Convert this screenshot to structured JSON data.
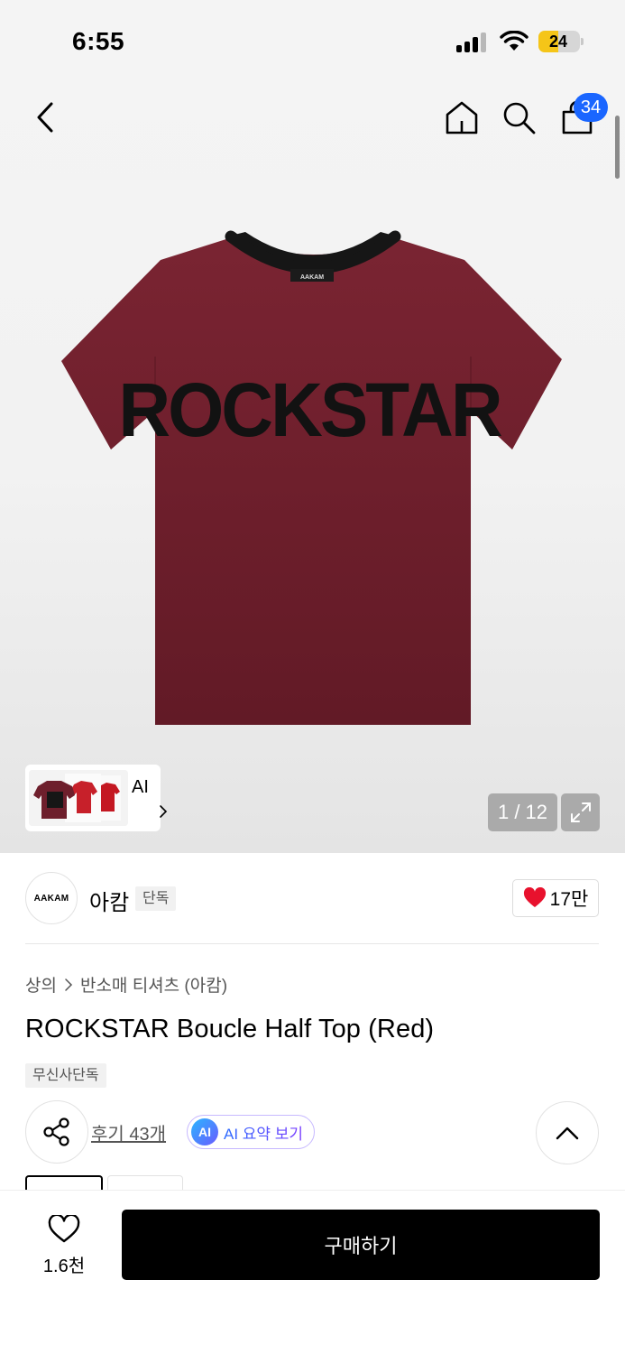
{
  "status_bar": {
    "time": "6:55",
    "battery": "24"
  },
  "header": {
    "cart_count": "34"
  },
  "gallery": {
    "ai_label": "AI",
    "counter": "1 / 12",
    "print_text": "ROCKSTAR",
    "collar_tag": "AAKAM"
  },
  "brand": {
    "logo_text": "AAKAM",
    "name": "아캄",
    "tag": "단독",
    "like_count": "17만"
  },
  "product": {
    "breadcrumb": [
      "상의",
      "반소매 티셔츠 (아캄)"
    ],
    "title": "ROCKSTAR Boucle Half Top (Red)",
    "exclusive_badge": "무신사단독",
    "review_link": "후기 43개",
    "ai_summary_icon": "AI",
    "ai_summary_label": "AI 요약 보기"
  },
  "bottom_bar": {
    "wish_count": "1.6천",
    "buy_label": "구매하기"
  },
  "colors": {
    "shirt": "#6c1f2b",
    "accent_blue": "#1a66ff",
    "heart": "#e8112d"
  }
}
